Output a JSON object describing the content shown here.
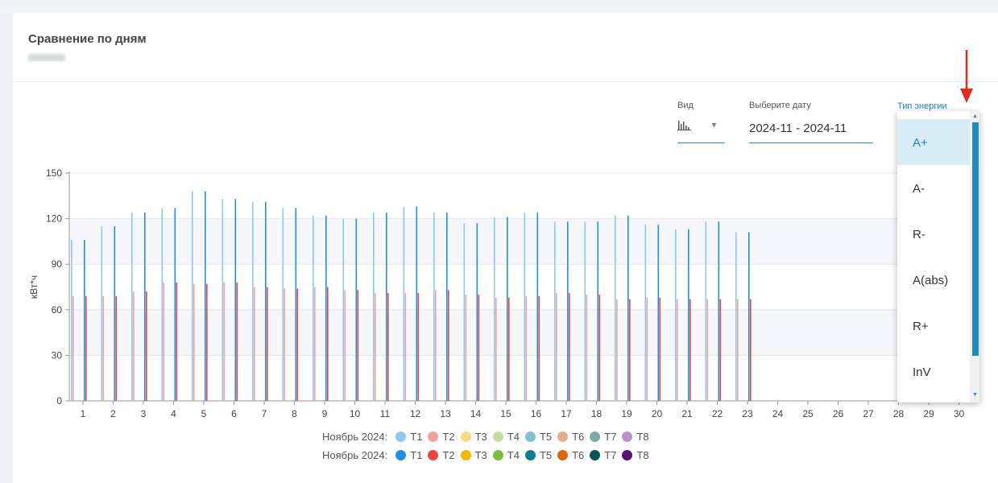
{
  "card": {
    "title": "Сравнение по дням",
    "subtitle": "67944"
  },
  "controls": {
    "view_label": "Вид",
    "view_icon": "bar-chart-icon",
    "date_label": "Выберите дату",
    "date_value": "2024-11 - 2024-11",
    "energy_label": "Тип энергии"
  },
  "dropdown": {
    "options": [
      "A+",
      "A-",
      "R-",
      "A(abs)",
      "R+",
      "InV"
    ],
    "selected": "A+"
  },
  "colors": {
    "accent": "#1a83c7",
    "series_prev": [
      "#8ec9f3",
      "#f3a39c",
      "#f7dc86",
      "#c2dfa3",
      "#82c2cf",
      "#e4b08c",
      "#7fa8a7",
      "#b695c4"
    ],
    "series_cur": [
      "#1f8fe8",
      "#f0453a",
      "#f3b800",
      "#7bbf3a",
      "#0c7f95",
      "#d9680a",
      "#06574f",
      "#5a1377"
    ]
  },
  "chart_data": {
    "type": "bar",
    "ylabel": "кВт*ч",
    "xlabel": "",
    "ylim": [
      0,
      150
    ],
    "yticks": [
      0,
      30,
      60,
      90,
      120,
      150
    ],
    "categories": [
      "1",
      "2",
      "3",
      "4",
      "5",
      "6",
      "7",
      "8",
      "9",
      "10",
      "11",
      "12",
      "13",
      "14",
      "15",
      "16",
      "17",
      "18",
      "19",
      "20",
      "21",
      "22",
      "23",
      "24",
      "25",
      "26",
      "27",
      "28",
      "29",
      "30"
    ],
    "series": [
      {
        "name": "Ноябрь 2024: T1",
        "values": [
          106,
          115,
          124,
          127,
          138,
          133,
          131,
          127,
          122,
          120,
          124,
          128,
          124,
          117,
          121,
          124,
          118,
          118,
          122,
          116,
          113,
          118,
          111,
          null,
          null,
          null,
          null,
          null,
          null,
          null
        ]
      },
      {
        "name": "Ноябрь 2024: T2",
        "values": [
          69,
          69,
          72,
          78,
          77,
          78,
          75,
          74,
          75,
          73,
          71,
          71,
          73,
          70,
          68,
          69,
          71,
          70,
          67,
          68,
          67,
          67,
          67,
          null,
          null,
          null,
          null,
          null,
          null,
          null
        ]
      },
      {
        "name": "Ноябрь 2024: T1",
        "values": [
          106,
          115,
          124,
          127,
          138,
          133,
          131,
          127,
          122,
          120,
          124,
          128,
          124,
          117,
          121,
          124,
          118,
          118,
          122,
          116,
          113,
          118,
          111,
          null,
          null,
          null,
          null,
          null,
          null,
          null
        ]
      },
      {
        "name": "Ноябрь 2024: T2",
        "values": [
          69,
          69,
          72,
          78,
          77,
          78,
          75,
          74,
          75,
          73,
          71,
          71,
          73,
          70,
          68,
          69,
          71,
          70,
          67,
          68,
          67,
          67,
          67,
          null,
          null,
          null,
          null,
          null,
          null,
          null
        ]
      }
    ],
    "legend": {
      "rows": [
        {
          "title": "Ноябрь 2024:",
          "items": [
            "T1",
            "T2",
            "T3",
            "T4",
            "T5",
            "T6",
            "T7",
            "T8"
          ]
        },
        {
          "title": "Ноябрь 2024:",
          "items": [
            "T1",
            "T2",
            "T3",
            "T4",
            "T5",
            "T6",
            "T7",
            "T8"
          ]
        }
      ],
      "position": "bottom-center"
    },
    "grid": true
  }
}
